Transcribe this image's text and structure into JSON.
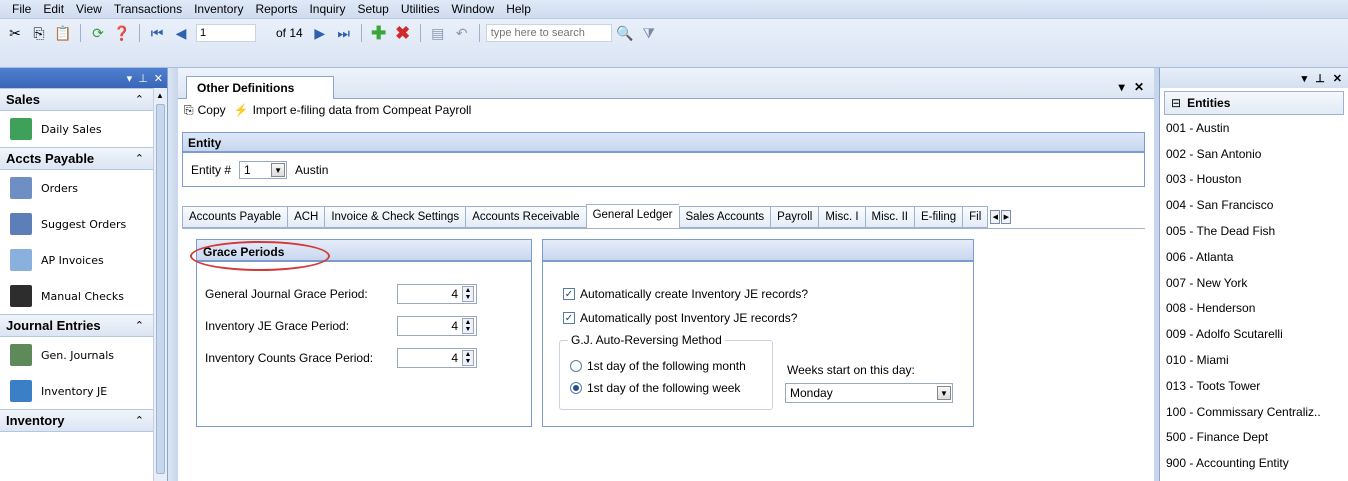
{
  "menu": [
    "File",
    "Edit",
    "View",
    "Transactions",
    "Inventory",
    "Reports",
    "Inquiry",
    "Setup",
    "Utilities",
    "Window",
    "Help"
  ],
  "toolbar": {
    "record_value": "1",
    "of_label": "of 14",
    "search_placeholder": "type here to search"
  },
  "leftnav": {
    "groups": [
      {
        "label": "Sales",
        "items": [
          {
            "label": "Daily Sales",
            "icon": "daily-sales-icon",
            "color": "#3fa05a"
          }
        ]
      },
      {
        "label": "Accts Payable",
        "items": [
          {
            "label": "Orders",
            "icon": "orders-icon",
            "color": "#6d8fc4"
          },
          {
            "label": "Suggest Orders",
            "icon": "suggest-orders-icon",
            "color": "#5c7fb8"
          },
          {
            "label": "AP Invoices",
            "icon": "ap-invoices-icon",
            "color": "#8ab0de"
          },
          {
            "label": "Manual Checks",
            "icon": "manual-checks-icon",
            "color": "#2d2d2d"
          }
        ]
      },
      {
        "label": "Journal Entries",
        "items": [
          {
            "label": "Gen. Journals",
            "icon": "gen-journals-icon",
            "color": "#5e8a5a"
          },
          {
            "label": "Inventory JE",
            "icon": "inventory-je-icon",
            "color": "#3b7fc7"
          }
        ]
      },
      {
        "label": "Inventory",
        "items": []
      }
    ]
  },
  "document": {
    "tab_title": "Other Definitions",
    "copy_label": "Copy",
    "import_label": "Import e-filing data from Compeat Payroll",
    "entity_header": "Entity",
    "entity_label": "Entity #",
    "entity_value": "1",
    "entity_name": "Austin",
    "settings_tabs": [
      "Accounts Payable",
      "ACH",
      "Invoice & Check Settings",
      "Accounts Receivable",
      "General Ledger",
      "Sales Accounts",
      "Payroll",
      "Misc. I",
      "Misc. II",
      "E-filing",
      "Fil"
    ],
    "active_tab": "General Ledger",
    "grace": {
      "title": "Grace Periods",
      "rows": [
        {
          "label": "General Journal Grace Period:",
          "value": "4"
        },
        {
          "label": "Inventory JE Grace Period:",
          "value": "4"
        },
        {
          "label": "Inventory Counts Grace Period:",
          "value": "4"
        }
      ]
    },
    "je": {
      "auto_create": "Automatically create Inventory JE records?",
      "auto_post": "Automatically post Inventory JE records?",
      "reversing_title": "G.J. Auto-Reversing Method",
      "opt_month": "1st day of the following month",
      "opt_week": "1st day of the following week",
      "weeks_label": "Weeks start on this day:",
      "weeks_value": "Monday"
    }
  },
  "entities": {
    "title": "Entities",
    "items": [
      "001 - Austin",
      "002 - San Antonio",
      "003 - Houston",
      "004 - San Francisco",
      "005 - The Dead Fish",
      "006 - Atlanta",
      "007 - New York",
      "008 - Henderson",
      "009 - Adolfo Scutarelli",
      "010 - Miami",
      "013 - Toots Tower",
      "100 - Commissary Centraliz..",
      "500 - Finance Dept",
      "900 - Accounting Entity"
    ]
  }
}
